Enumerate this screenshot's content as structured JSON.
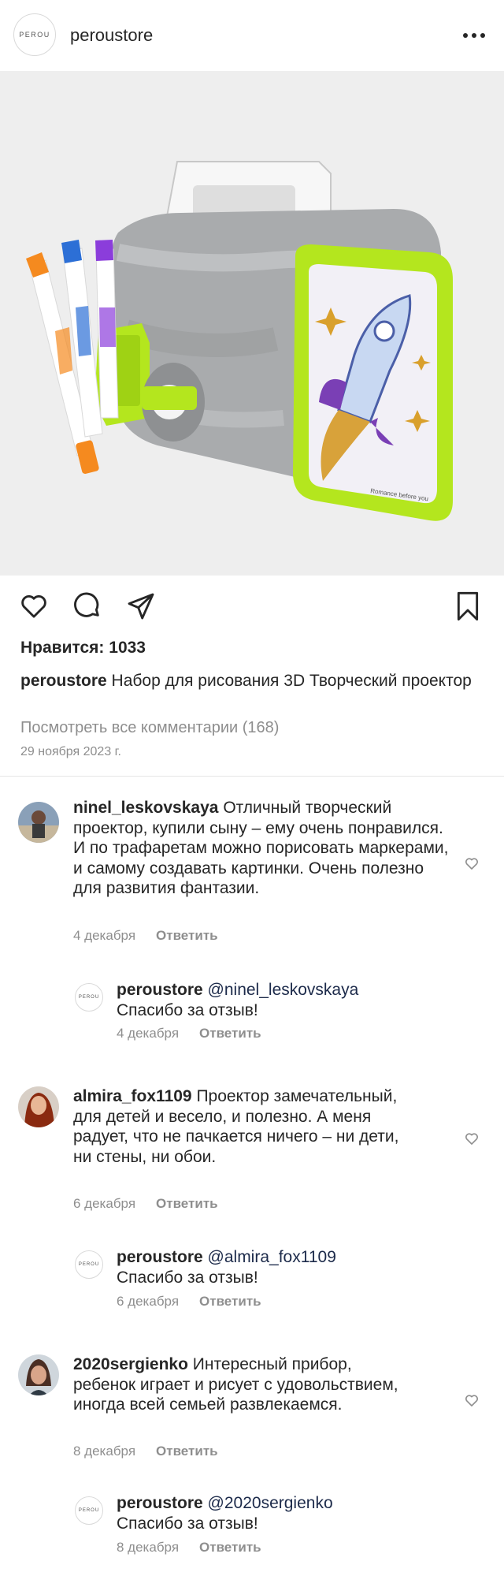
{
  "header": {
    "logo_text": "PEROU",
    "username": "peroustore",
    "more_icon": "more-horizontal-icon"
  },
  "post": {
    "likes_label": "Нравится: 1033",
    "caption_user": "peroustore",
    "caption_text": "Набор для рисования 3D Творческий проектор",
    "view_comments": "Посмотреть все комментарии (168)",
    "date": "29 ноября 2023 г.",
    "product_label": "Romance before you"
  },
  "comments": [
    {
      "user": "ninel_leskovskaya",
      "text": "Отличный творческий проектор, купили сыну – ему очень понравился. И по трафаретам можно порисовать маркерами, и самому создавать картинки. Очень полезно для развития фантазии.",
      "date": "4 декабря",
      "reply": "Ответить"
    },
    {
      "user": "peroustore",
      "mention": "@ninel_leskovskaya",
      "text": "Спасибо за отзыв!",
      "date": "4 декабря",
      "reply": "Ответить"
    },
    {
      "user": "almira_fox1109",
      "text": "Проектор замечательный, для детей и весело, и полезно. А меня радует, что не пачкается ничего – ни дети, ни стены, ни обои.",
      "date": "6 декабря",
      "reply": "Ответить"
    },
    {
      "user": "peroustore",
      "mention": "@almira_fox1109",
      "text": "Спасибо за отзыв!",
      "date": "6 декабря",
      "reply": "Ответить"
    },
    {
      "user": "2020sergienko",
      "text": "Интересный прибор, ребенок играет и рисует с удовольствием, иногда всей семьей развлекаемся.",
      "date": "8 декабря",
      "reply": "Ответить"
    },
    {
      "user": "peroustore",
      "mention": "@2020sergienko",
      "text": "Спасибо за отзыв!",
      "date": "8 декабря",
      "reply": "Ответить"
    }
  ],
  "colors": {
    "text": "#262626",
    "muted": "#8e8e8e",
    "projector_green": "#b4e61e",
    "projector_gray": "#a9abad"
  }
}
